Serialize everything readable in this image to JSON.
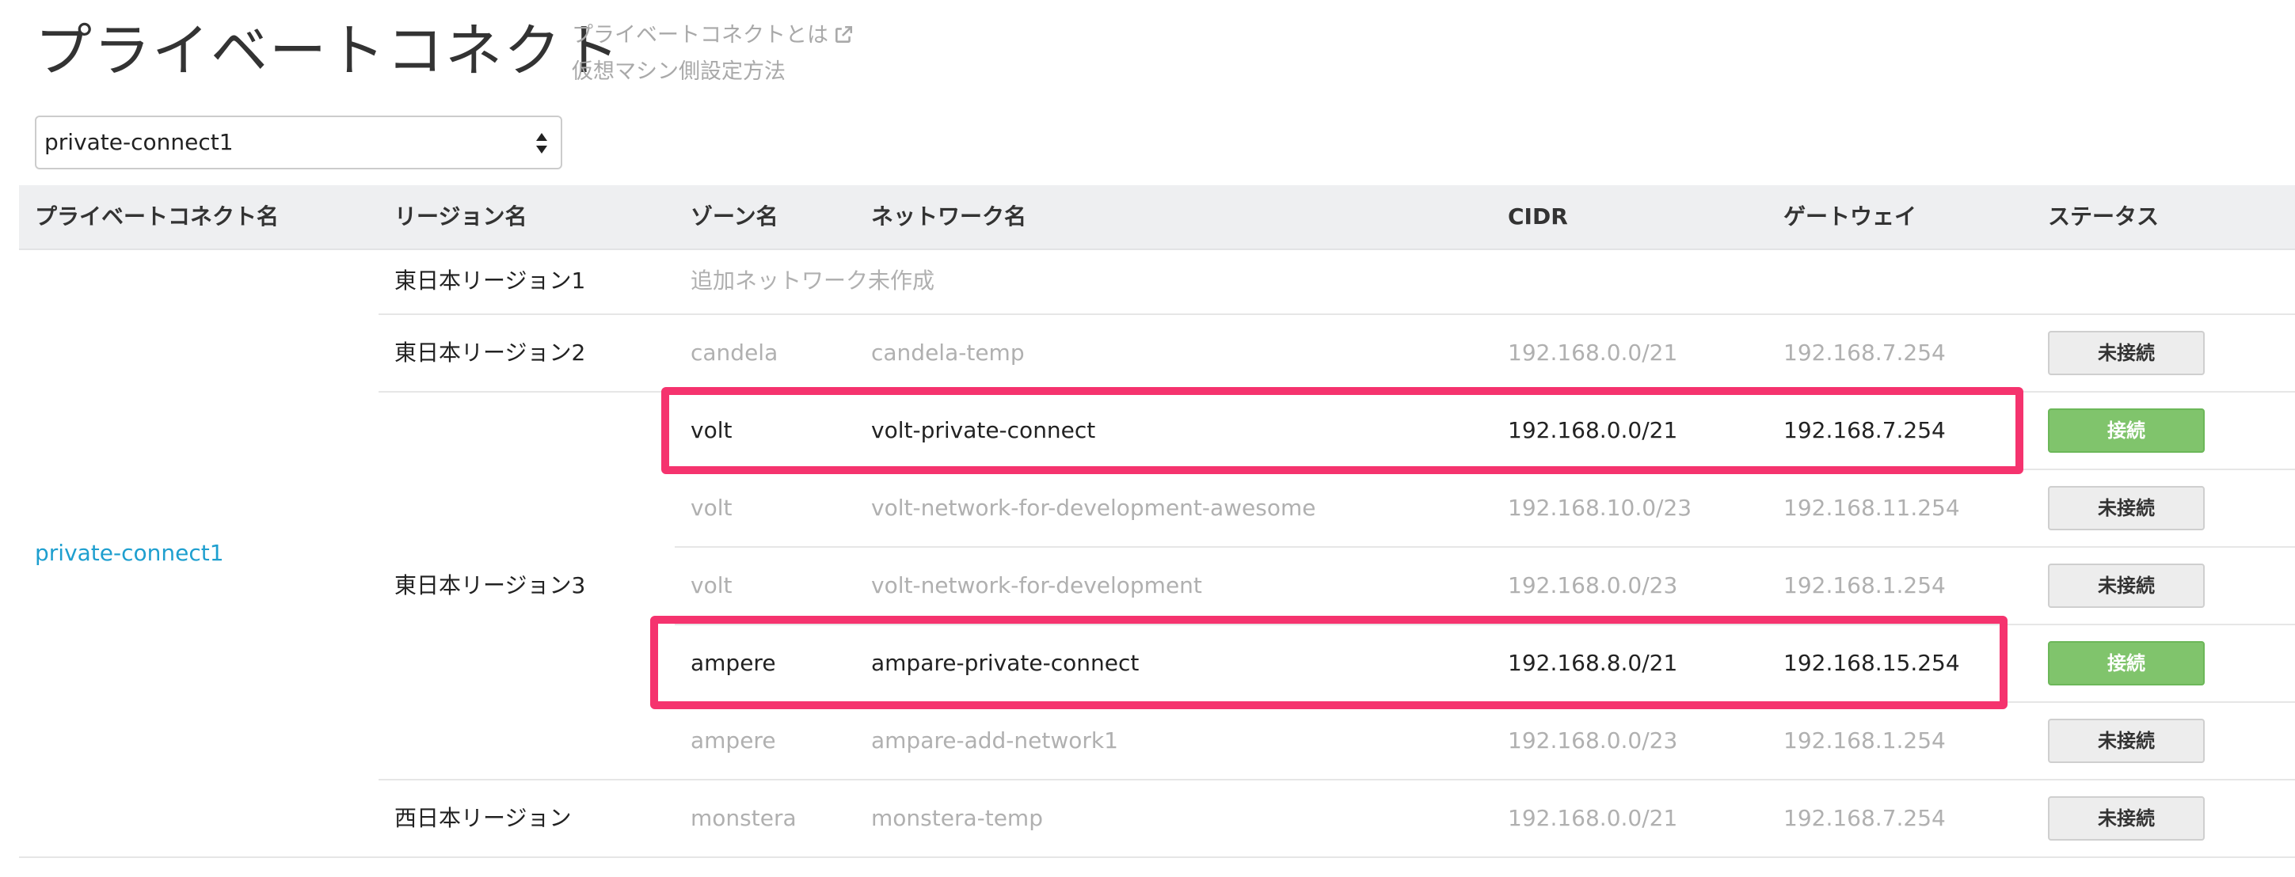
{
  "page": {
    "title": "プライベートコネクト",
    "help_link_1": "プライベートコネクトとは",
    "help_link_2": "仮想マシン側設定方法"
  },
  "selector": {
    "selected": "private-connect1"
  },
  "table": {
    "headers": [
      "プライベートコネクト名",
      "リージョン名",
      "ゾーン名",
      "ネットワーク名",
      "CIDR",
      "ゲートウェイ",
      "ステータス"
    ],
    "connect_name": "private-connect1",
    "regions": [
      "東日本リージョン1",
      "東日本リージョン2",
      "東日本リージョン3",
      "西日本リージョン"
    ],
    "region1_message": "追加ネットワーク未作成",
    "rows": [
      {
        "zone": "candela",
        "network": "candela-temp",
        "cidr": "192.168.0.0/21",
        "gateway": "192.168.7.254",
        "status": "未接続"
      },
      {
        "zone": "volt",
        "network": "volt-private-connect",
        "cidr": "192.168.0.0/21",
        "gateway": "192.168.7.254",
        "status": "接続"
      },
      {
        "zone": "volt",
        "network": "volt-network-for-development-awesome",
        "cidr": "192.168.10.0/23",
        "gateway": "192.168.11.254",
        "status": "未接続"
      },
      {
        "zone": "volt",
        "network": "volt-network-for-development",
        "cidr": "192.168.0.0/23",
        "gateway": "192.168.1.254",
        "status": "未接続"
      },
      {
        "zone": "ampere",
        "network": "ampare-private-connect",
        "cidr": "192.168.8.0/21",
        "gateway": "192.168.15.254",
        "status": "接続"
      },
      {
        "zone": "ampere",
        "network": "ampare-add-network1",
        "cidr": "192.168.0.0/23",
        "gateway": "192.168.1.254",
        "status": "未接続"
      },
      {
        "zone": "monstera",
        "network": "monstera-temp",
        "cidr": "192.168.0.0/21",
        "gateway": "192.168.7.254",
        "status": "未接続"
      }
    ]
  },
  "colors": {
    "highlight": "#f5336e",
    "connected_button": "#80c46c",
    "link": "#1e9fcf",
    "header_bg": "#eeeff1"
  },
  "icons": {
    "external_link": "external-link-icon",
    "select_arrows": "select-arrows-icon"
  }
}
